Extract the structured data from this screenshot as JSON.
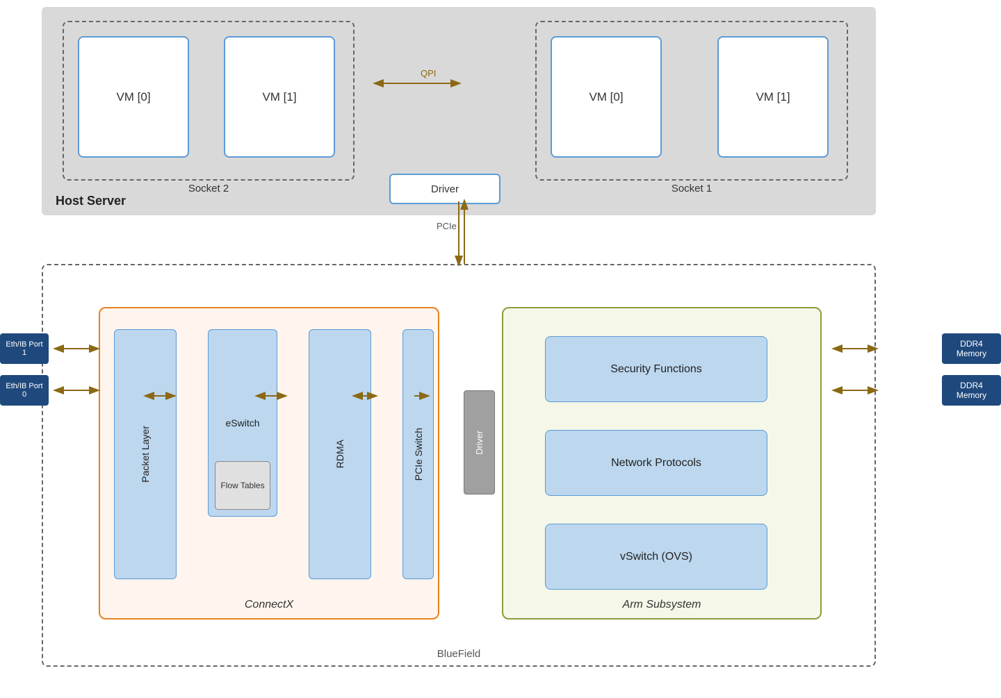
{
  "host_server": {
    "label": "Host Server",
    "socket2": {
      "label": "Socket 2",
      "vm0": "VM [0]",
      "vm1": "VM [1]"
    },
    "socket1": {
      "label": "Socket 1",
      "vm0": "VM [0]",
      "vm1": "VM [1]"
    },
    "driver": "Driver",
    "qpi_label": "QPI",
    "pcie_label": "PCIe"
  },
  "bluefield": {
    "label": "BlueField",
    "connectx": {
      "label": "ConnectX",
      "packet_layer": "Packet Layer",
      "eswitch": "eSwitch",
      "flow_tables": "Flow Tables",
      "rdma": "RDMA",
      "pcie_switch": "PCIe Switch"
    },
    "driver": "Driver",
    "arm": {
      "label": "Arm Subsystem",
      "security_functions": "Security Functions",
      "network_protocols": "Network Protocols",
      "vswitch_ovs": "vSwitch (OVS)"
    }
  },
  "ports": {
    "eth_ib_port1": "Eth/IB Port 1",
    "eth_ib_port0": "Eth/IB Port 0",
    "ddr4_1": "DDR4 Memory",
    "ddr4_2": "DDR4 Memory"
  }
}
